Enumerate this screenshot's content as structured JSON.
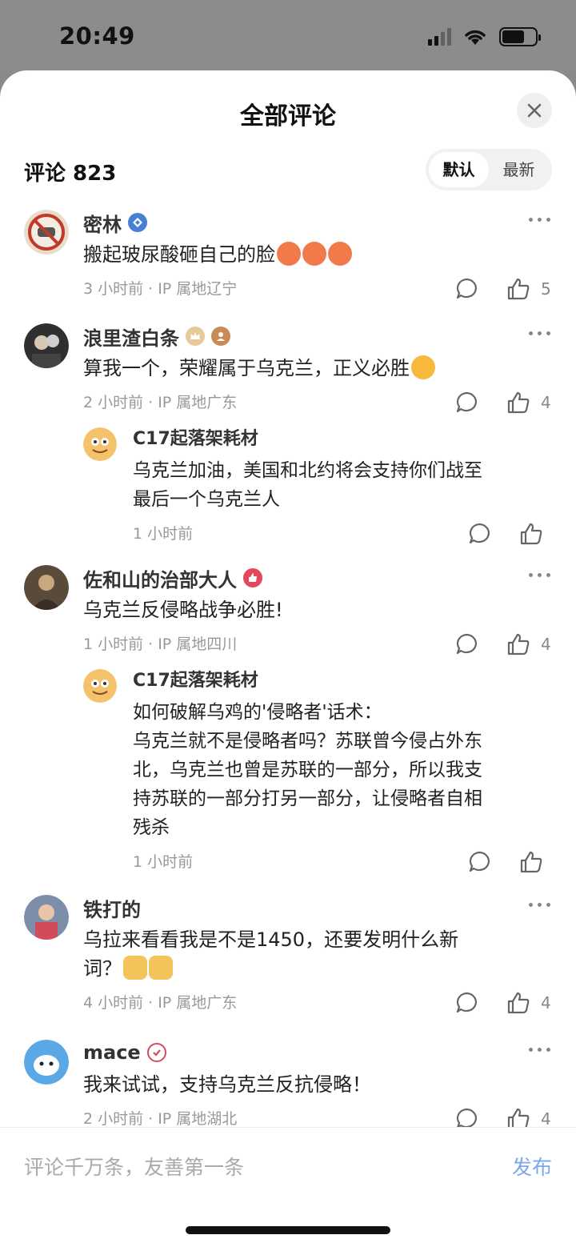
{
  "status": {
    "time": "20:49"
  },
  "sheet": {
    "title": "全部评论",
    "count_label": "评论 823",
    "sort": {
      "default": "默认",
      "latest": "最新"
    }
  },
  "comments": [
    {
      "name": "密林",
      "text": "搬起玻尿酸砸自己的脸",
      "time": "3 小时前",
      "ip": "IP 属地辽宁",
      "likes": "5"
    },
    {
      "name": "浪里渣白条",
      "text": "算我一个，荣耀属于乌克兰，正义必胜",
      "time": "2 小时前",
      "ip": "IP 属地广东",
      "likes": "4",
      "reply": {
        "name": "C17起落架耗材",
        "text_lines": [
          "乌克兰加油，美国和北约将会支持你们战至",
          "最后一个乌克兰人"
        ],
        "time": "1 小时前"
      }
    },
    {
      "name": "佐和山的治部大人",
      "text": "乌克兰反侵略战争必胜!",
      "time": "1 小时前",
      "ip": "IP 属地四川",
      "likes": "4",
      "reply": {
        "name": "C17起落架耗材",
        "text_lines": [
          "如何破解乌鸡的'侵略者'话术：",
          "乌克兰就不是侵略者吗？苏联曾今侵占外东",
          "北，乌克兰也曾是苏联的一部分，所以我支",
          "持苏联的一部分打另一部分，让侵略者自相",
          "残杀"
        ],
        "time": "1 小时前"
      }
    },
    {
      "name": "铁打的",
      "text_lines": [
        "乌拉来看看我是不是1450，还要发明什么新",
        "词？"
      ],
      "time": "4 小时前",
      "ip": "IP 属地广东",
      "likes": "4"
    },
    {
      "name": "mace",
      "text": "我来试试，支持乌克兰反抗侵略！",
      "time": "2 小时前",
      "ip": "IP 属地湖北",
      "likes": "4"
    }
  ],
  "input": {
    "placeholder": "评论千万条，友善第一条",
    "publish": "发布"
  },
  "colors": {
    "accent": "#7ca7e8",
    "meta": "#999999"
  },
  "icons": [
    "close-icon",
    "more-icon",
    "reply-icon",
    "like-icon",
    "signal-icon",
    "wifi-icon",
    "battery-icon"
  ]
}
